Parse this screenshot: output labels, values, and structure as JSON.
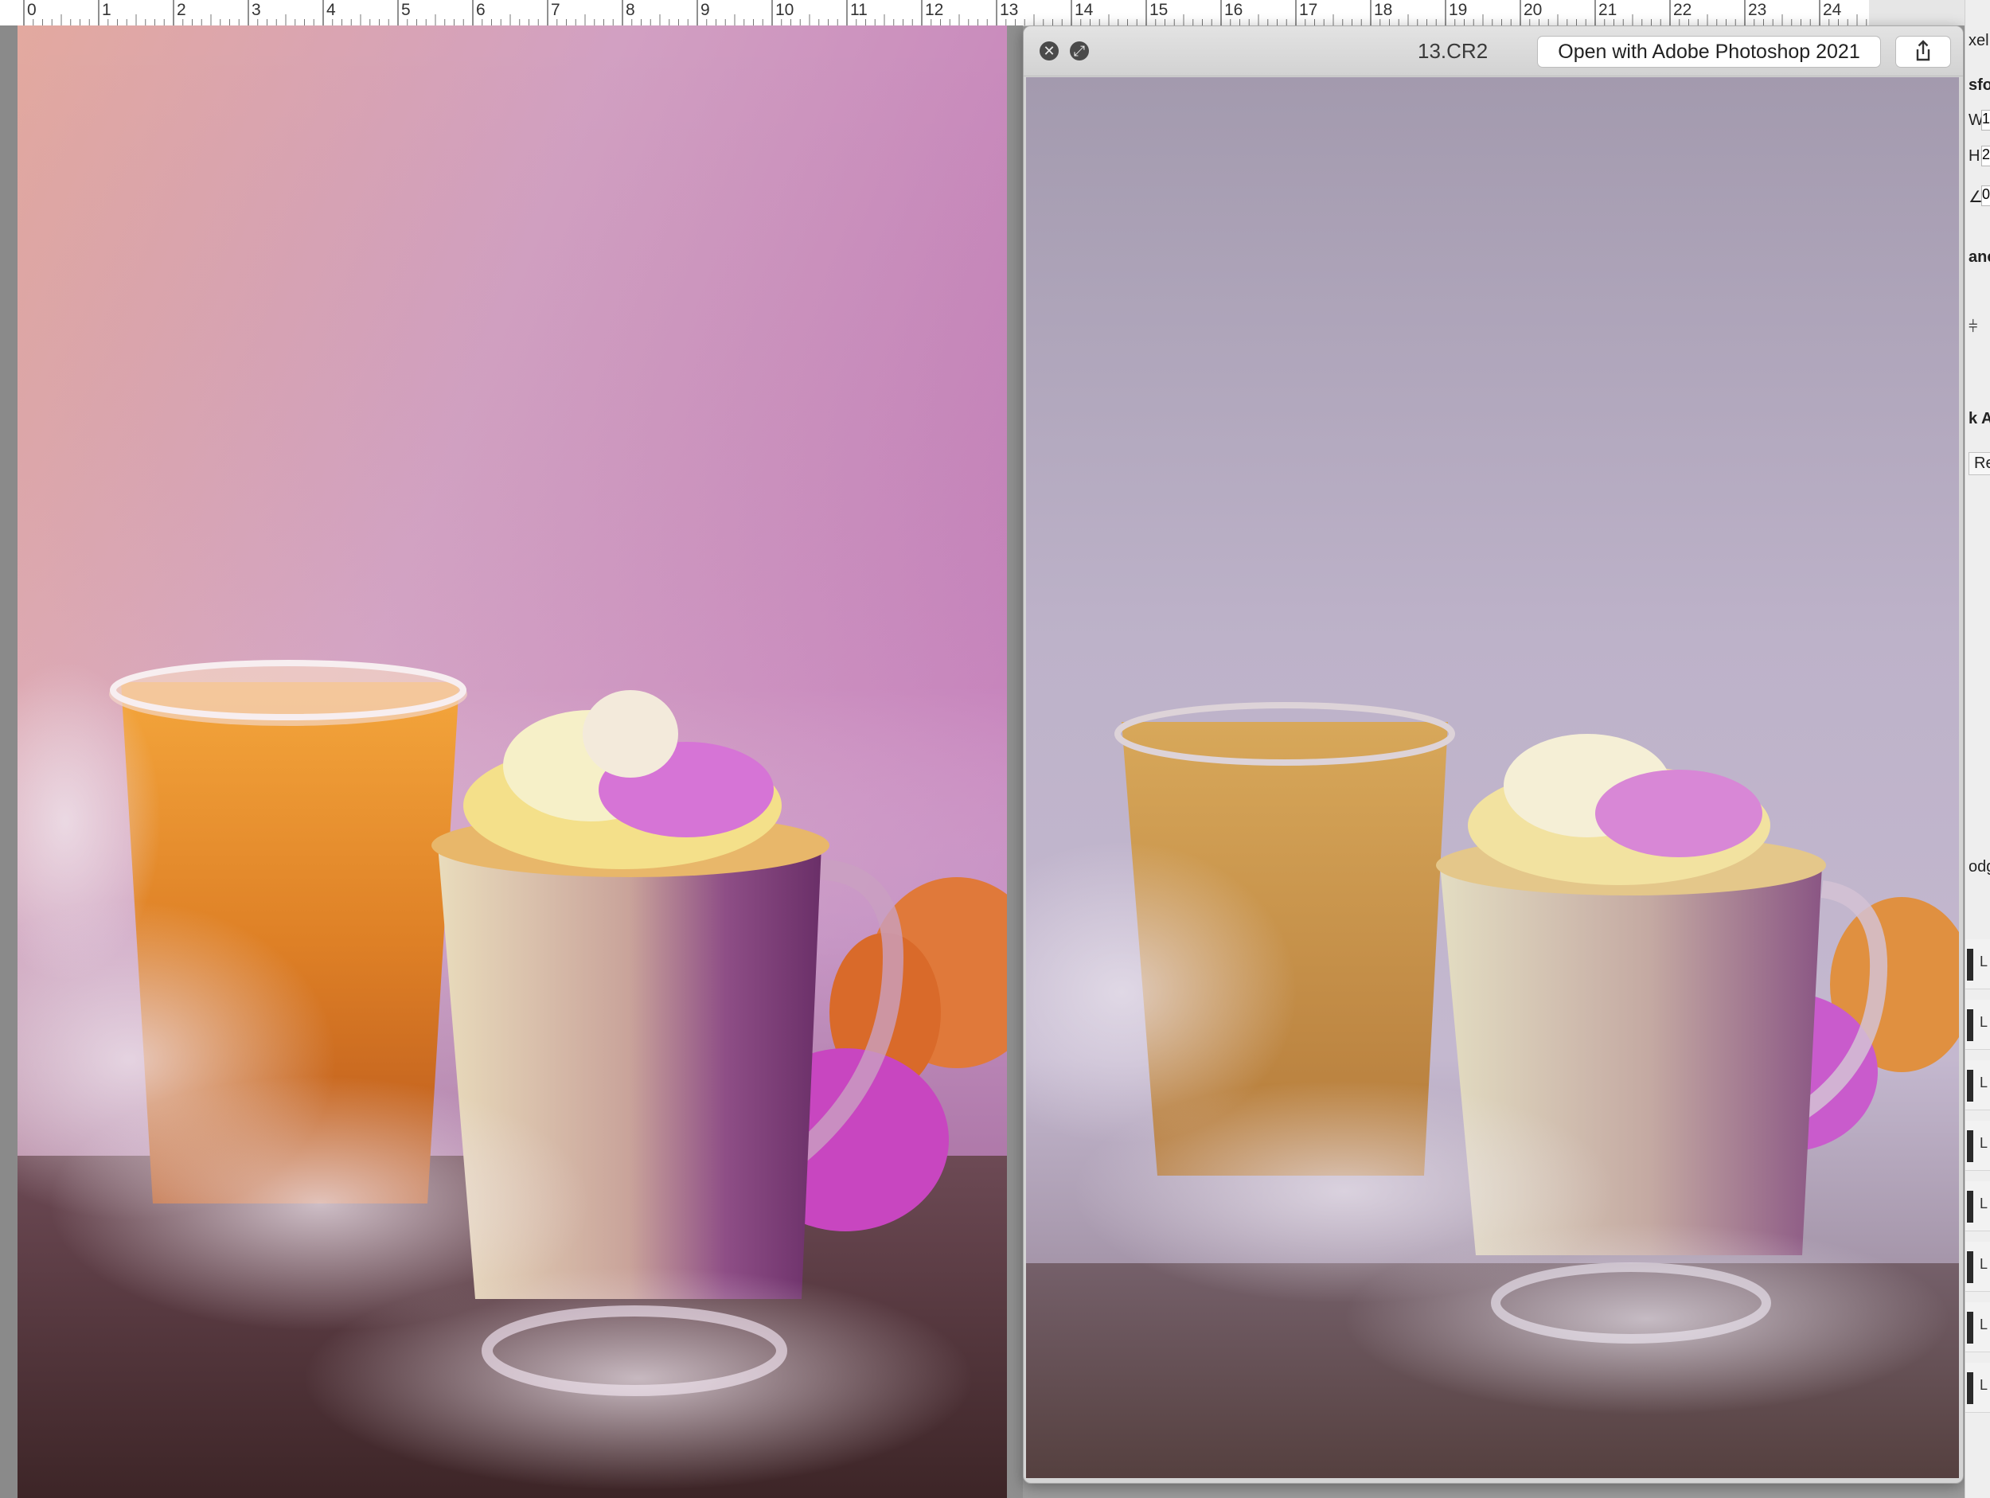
{
  "ruler": {
    "units": [
      "0",
      "1",
      "2",
      "3",
      "4",
      "5",
      "6",
      "7",
      "8",
      "9",
      "10",
      "11",
      "12",
      "13",
      "14",
      "15",
      "16",
      "17",
      "18",
      "19",
      "20",
      "21",
      "22",
      "23",
      "24"
    ]
  },
  "canvas": {
    "description_icon": "photo-canvas"
  },
  "quicklook": {
    "filename": "13.CR2",
    "open_button_label": "Open with Adobe Photoshop 2021",
    "close_icon": "close-icon",
    "fullscreen_icon": "fullscreen-icon",
    "share_icon": "share-icon"
  },
  "ps_panel": {
    "top_fragment": "xel",
    "transform_fragment": "sfor",
    "w_label": "W",
    "w_value": "1",
    "h_label": "H",
    "h_value": "2",
    "angle_label": "∠",
    "angle_value": "0",
    "align_fragment": "anc",
    "actions_fragment": "k Ac",
    "re_fragment": "Re",
    "dodge_fragment": "odg",
    "layer_label": "L"
  },
  "colors": {
    "ruler_bg": "#ffffff",
    "window_chrome": "#d4d4d4",
    "app_bg": "#9c9c9c"
  }
}
